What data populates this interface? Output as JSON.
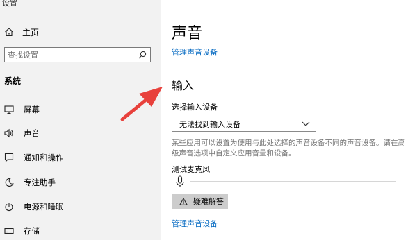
{
  "window": {
    "title": "设置"
  },
  "sidebar": {
    "home_label": "主页",
    "search": {
      "placeholder": "查找设置"
    },
    "section_label": "系统",
    "items": [
      {
        "label": "屏幕",
        "icon": "monitor-icon"
      },
      {
        "label": "声音",
        "icon": "speaker-icon"
      },
      {
        "label": "通知和操作",
        "icon": "notification-icon"
      },
      {
        "label": "专注助手",
        "icon": "moon-icon"
      },
      {
        "label": "电源和睡眠",
        "icon": "power-icon"
      },
      {
        "label": "存储",
        "icon": "storage-icon"
      }
    ]
  },
  "main": {
    "title": "声音",
    "manage_link_top": "管理声音设备",
    "input_section_title": "输入",
    "input_device_label": "选择输入设备",
    "input_device_value": "无法找到输入设备",
    "description": "某些应用可以设置为使用与此处选择的声音设备不同的声音设备。请在高级声音选项中自定义应用音量和设备。",
    "mic_test_label": "测试麦克风",
    "mic_level": 0,
    "troubleshoot_label": "疑难解答",
    "manage_link_bottom": "管理声音设备"
  },
  "colors": {
    "sidebar_bg": "#f2f2f2",
    "link": "#0067c0",
    "arrow": "#e8413c",
    "button_bg": "#cccccc"
  }
}
